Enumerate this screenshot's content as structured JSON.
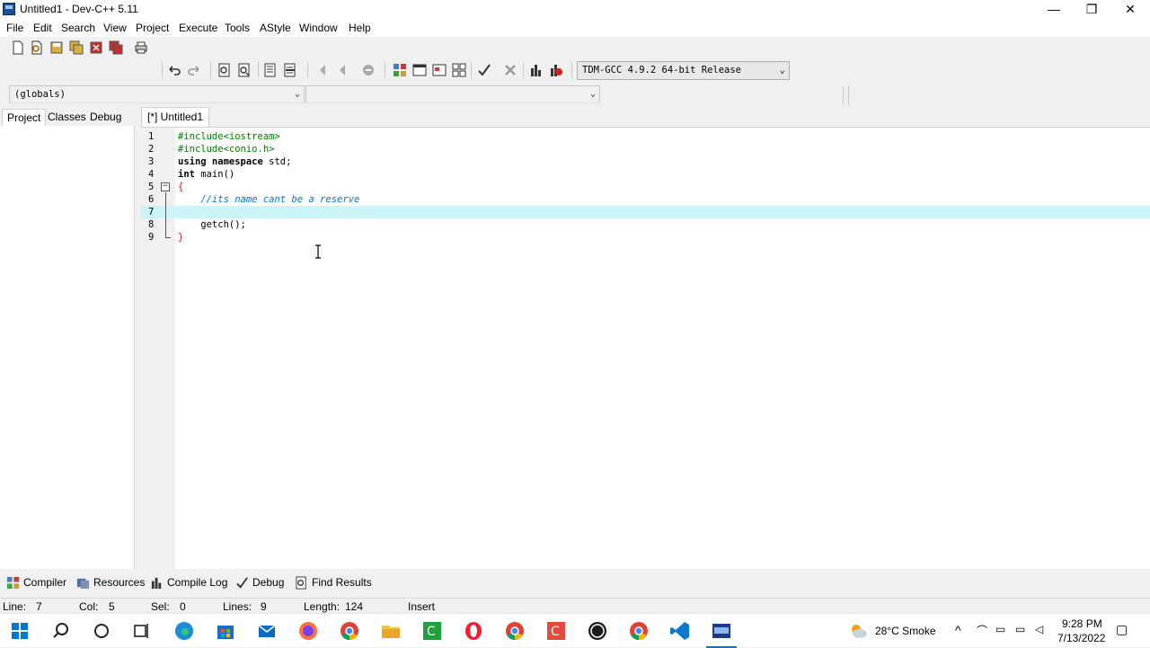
{
  "window": {
    "title": "Untitled1 - Dev-C++ 5.11"
  },
  "menu": [
    "File",
    "Edit",
    "Search",
    "View",
    "Project",
    "Execute",
    "Tools",
    "AStyle",
    "Window",
    "Help"
  ],
  "toolbar": {
    "compiler": "TDM-GCC 4.9.2 64-bit Release"
  },
  "scope": {
    "globals": "(globals)",
    "member": ""
  },
  "left_tabs": [
    "Project",
    "Classes",
    "Debug"
  ],
  "editor": {
    "tab": "[*] Untitled1",
    "lines": [
      {
        "n": "1",
        "text": "#include<iostream>"
      },
      {
        "n": "2",
        "text": "#include<conio.h>"
      },
      {
        "n": "3",
        "kw": "using namespace",
        "rest": " std;"
      },
      {
        "n": "4",
        "kw": "int",
        "rest": " main()"
      },
      {
        "n": "5",
        "text": "{"
      },
      {
        "n": "6",
        "text": "    //its name cant be a reserve"
      },
      {
        "n": "7",
        "text": ""
      },
      {
        "n": "8",
        "text": "    getch();"
      },
      {
        "n": "9",
        "text": "}"
      }
    ]
  },
  "bottom_tabs": [
    "Compiler",
    "Resources",
    "Compile Log",
    "Debug",
    "Find Results"
  ],
  "status": {
    "line_label": "Line:",
    "line": "7",
    "col_label": "Col:",
    "col": "5",
    "sel_label": "Sel:",
    "sel": "0",
    "lines_label": "Lines:",
    "lines": "9",
    "length_label": "Length:",
    "length": "124",
    "mode": "Insert"
  },
  "tray": {
    "weather": "28°C  Smoke",
    "time": "9:28 PM",
    "date": "7/13/2022"
  },
  "colors": {
    "current_line": "#ccf5fa",
    "comment": "#0078d7",
    "preprocessor": "#008000",
    "brace": "#ff0000"
  }
}
